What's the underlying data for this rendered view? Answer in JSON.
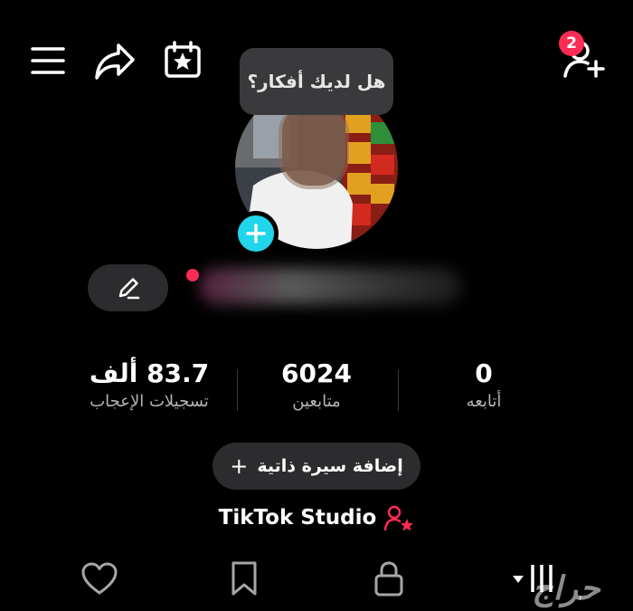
{
  "header": {
    "menu_icon": "hamburger-menu-icon",
    "share_icon": "share-arrow-icon",
    "calendar_icon": "calendar-star-icon",
    "add_friend_icon": "add-user-icon",
    "notification_badge": "2"
  },
  "profile": {
    "thought_prompt": "هل لديك أفكار؟",
    "add_photo_icon": "plus-icon",
    "edit_icon": "pencil-icon"
  },
  "stats": [
    {
      "value": "0",
      "label": "أتابعه"
    },
    {
      "value": "6024",
      "label": "متابعين"
    },
    {
      "value": "83.7 ألف",
      "label": "تسجيلات الإعجاب"
    }
  ],
  "bio_button": {
    "label": "إضافة سيرة ذاتية",
    "icon": "+"
  },
  "studio": {
    "label": "TikTok Studio",
    "icon": "creator-star-icon"
  },
  "tabs": [
    {
      "name": "liked",
      "icon": "heart-icon"
    },
    {
      "name": "saved",
      "icon": "bookmark-icon"
    },
    {
      "name": "private",
      "icon": "lock-icon"
    },
    {
      "name": "videos",
      "icon": "grid-icon"
    }
  ],
  "watermark": "حراج",
  "colors": {
    "accent_red": "#fe2c55",
    "accent_cyan": "#20d5ec",
    "surface": "#2c2c2e",
    "background": "#000000"
  }
}
